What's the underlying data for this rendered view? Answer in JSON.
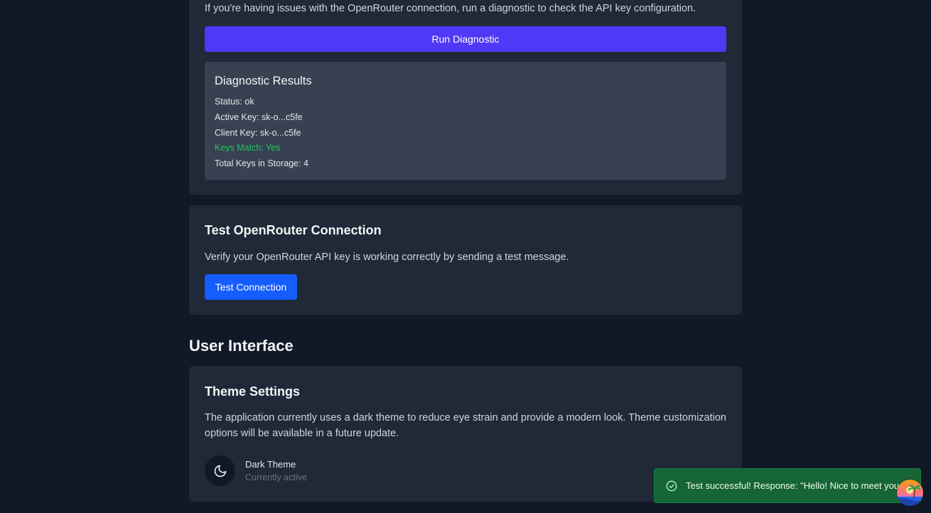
{
  "diagnostic": {
    "description": "If you're having issues with the OpenRouter connection, run a diagnostic to check the API key configuration.",
    "run_button": "Run Diagnostic",
    "results_title": "Diagnostic Results",
    "status": "Status: ok",
    "active_key": "Active Key: sk-o...c5fe",
    "client_key": "Client Key: sk-o...c5fe",
    "keys_match": "Keys Match: Yes",
    "total_keys": "Total Keys in Storage: 4"
  },
  "test_connection": {
    "title": "Test OpenRouter Connection",
    "description": "Verify your OpenRouter API key is working correctly by sending a test message.",
    "button": "Test Connection"
  },
  "user_interface": {
    "heading": "User Interface",
    "theme": {
      "title": "Theme Settings",
      "description": "The application currently uses a dark theme to reduce eye strain and provide a modern look. Theme customization options will be available in a future update.",
      "name": "Dark Theme",
      "status": "Currently active",
      "icon": "moon-icon"
    }
  },
  "toast": {
    "message": "Test successful! Response: \"Hello! Nice to meet you.\"",
    "icon": "check-circle-icon"
  },
  "colors": {
    "background": "#111827",
    "card": "#1f2937",
    "results_panel": "#374151",
    "run_button": "#4f39f6",
    "test_button": "#155dfc",
    "success_text": "#22c55e",
    "toast_bg": "#166534"
  }
}
